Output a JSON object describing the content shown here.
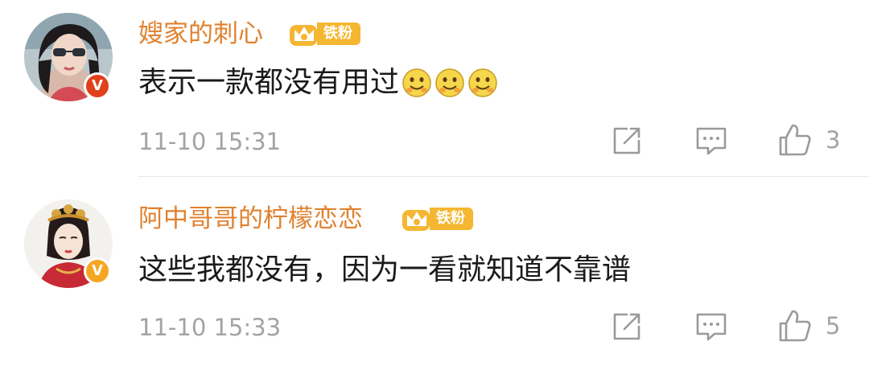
{
  "colors": {
    "username": "#e0812f",
    "badge_gold": "#f5b731",
    "verified_red": "#e0401b",
    "verified_orange": "#f5a623",
    "text": "#1a1a1a",
    "meta": "#a3a3a3"
  },
  "comments": [
    {
      "username": "嫂家的刺心",
      "fan_badge": "铁粉",
      "text": "表示一款都没有用过",
      "emojis": [
        "smile-emoji",
        "smile-emoji",
        "smile-emoji"
      ],
      "time": "11-10 15:31",
      "likes": "3",
      "verified_badge": "V",
      "icons": {
        "share": "share-icon",
        "comment": "comment-icon",
        "like": "thumbs-up-icon"
      }
    },
    {
      "username": "阿中哥哥的柠檬恋恋",
      "fan_badge": "铁粉",
      "text": "这些我都没有，因为一看就知道不靠谱",
      "emojis": [],
      "time": "11-10 15:33",
      "likes": "5",
      "verified_badge": "V",
      "icons": {
        "share": "share-icon",
        "comment": "comment-icon",
        "like": "thumbs-up-icon"
      }
    }
  ]
}
